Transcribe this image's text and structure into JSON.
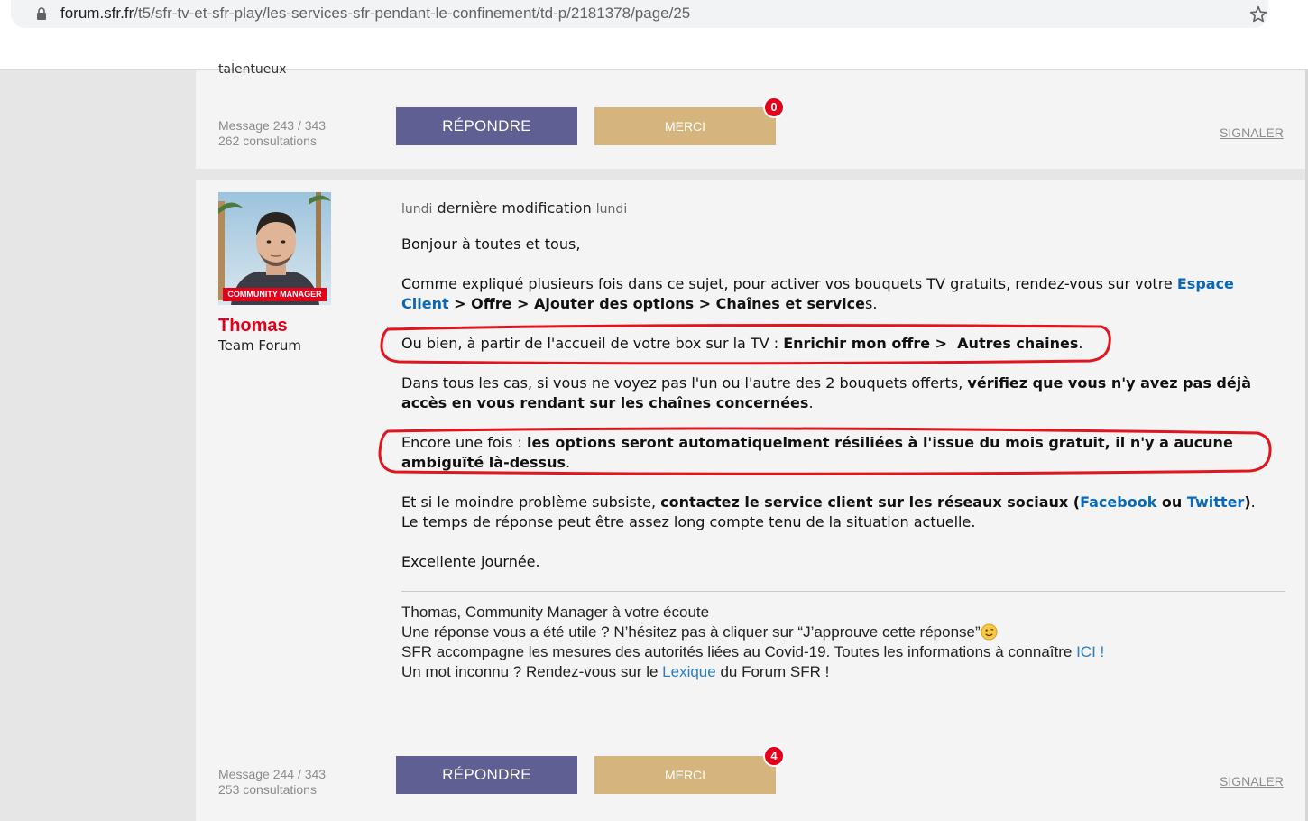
{
  "browser": {
    "url_host": "forum.sfr.fr",
    "url_path": "/t5/sfr-tv-et-sfr-play/les-services-sfr-pendant-le-confinement/td-p/2181378/page/25"
  },
  "post_prev": {
    "cut_text": "talentueux",
    "message_label": "Message 243 / 343",
    "views": "262 consultations",
    "reply_label": "RÉPONDRE",
    "merci_label": "MERCI",
    "merci_count": "0",
    "report_label": "SIGNALER"
  },
  "post": {
    "author": {
      "avatar_label": "COMMUNITY MANAGER",
      "name": "Thomas",
      "rank": "Team Forum"
    },
    "meta": {
      "date": "lundi",
      "modified": "dernière modification",
      "modified_date": "lundi"
    },
    "greeting": "Bonjour à toutes et tous,",
    "p1": {
      "text": "Comme expliqué plusieurs fois dans ce sujet, pour activer vos bouquets TV gratuits, rendez-vous sur votre ",
      "link": "Espace Client",
      "path1": " > Offre > Ajouter des options > Chaînes et service",
      "path2": "s",
      "end": "."
    },
    "p2": {
      "text": "Ou bien, à partir de l'accueil de votre box sur la TV : ",
      "bold": "Enrichir mon offre >  Autres chaines",
      "end": "."
    },
    "p3": {
      "text": "Dans tous les cas, si vous ne voyez pas l'un ou l'autre des 2 bouquets offerts, ",
      "bold": "vérifiez que vous n'y avez pas déjà accès en vous rendant sur les chaînes concernées",
      "end": "."
    },
    "p4": {
      "text": "Encore une fois : ",
      "bold": "les options seront automatiquelment résiliées à l'issue du mois gratuit, il n'y a aucune ambiguïté là-dessus",
      "end": "."
    },
    "p5": {
      "text": "Et si le moindre problème subsiste, ",
      "bold": "contactez le service client sur les réseaux sociaux (",
      "link1": "Facebook",
      "ou": " ou ",
      "link2": "Twitter",
      "close": ")",
      "end": ".",
      "line2": "Le temps de réponse peut être assez long compte tenu de la situation actuelle."
    },
    "closing": "Excellente journée.",
    "signature": {
      "line1": "Thomas, Community Manager à votre écoute",
      "line2": "Une réponse vous a été utile ? N’hésitez pas à cliquer sur “J’approuve cette réponse”",
      "line3": "SFR accompagne les mesures des autorités liées au Covid-19. Toutes les informations à connaître ",
      "line3_link": "ICI !",
      "line4a": "Un mot inconnu ? Rendez-vous sur le ",
      "line4_link": "Lexique",
      "line4b": " du Forum SFR !"
    },
    "message_label": "Message 244 / 343",
    "views": "253 consultations",
    "reply_label": "RÉPONDRE",
    "merci_label": "MERCI",
    "merci_count": "4",
    "report_label": "SIGNALER"
  },
  "colors": {
    "reply_button": "#5f5f94",
    "merci_button": "#d5b57d",
    "badge": "#e2001a",
    "author_name": "#e2001a",
    "link": "#0a68b6",
    "highlight_ring": "#e0161f"
  }
}
